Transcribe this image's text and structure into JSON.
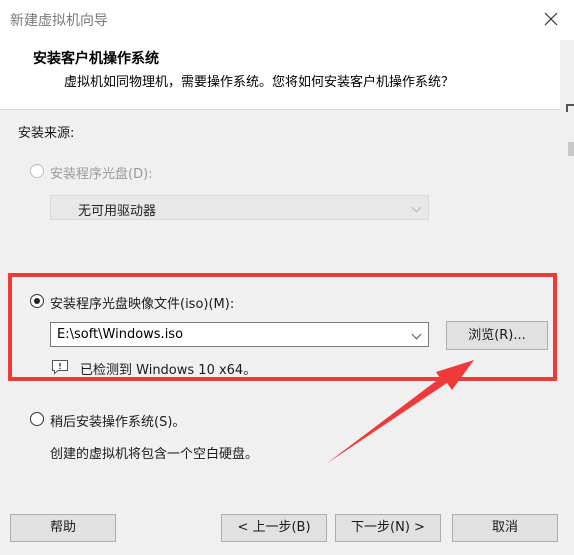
{
  "window": {
    "title": "新建虚拟机向导"
  },
  "header": {
    "title": "安装客户机操作系统",
    "subtitle": "虚拟机如同物理机，需要操作系统。您将如何安装客户机操作系统？"
  },
  "source": {
    "label": "安装来源:",
    "options": [
      {
        "label": "安装程序光盘(D):",
        "selected": false,
        "enabled": false
      },
      {
        "label": "安装程序光盘映像文件(iso)(M):",
        "selected": true,
        "enabled": true
      },
      {
        "label": "稍后安装操作系统(S)。",
        "selected": false,
        "enabled": true
      }
    ]
  },
  "drive_combo": {
    "value": "无可用驱动器"
  },
  "iso_combo": {
    "value": "E:\\soft\\Windows.iso"
  },
  "browse_label": "浏览(R)...",
  "detected": "已检测到 Windows 10 x64。",
  "later_description": "创建的虚拟机将包含一个空白硬盘。",
  "footer": {
    "help": "帮助",
    "back": "< 上一步(B)",
    "next": "下一步(N) >",
    "cancel": "取消"
  },
  "colors": {
    "annotation_red": "#ee3a3a"
  },
  "icons": [
    "close-icon",
    "info-icon",
    "chevron-down-icon",
    "annotation-arrow"
  ]
}
